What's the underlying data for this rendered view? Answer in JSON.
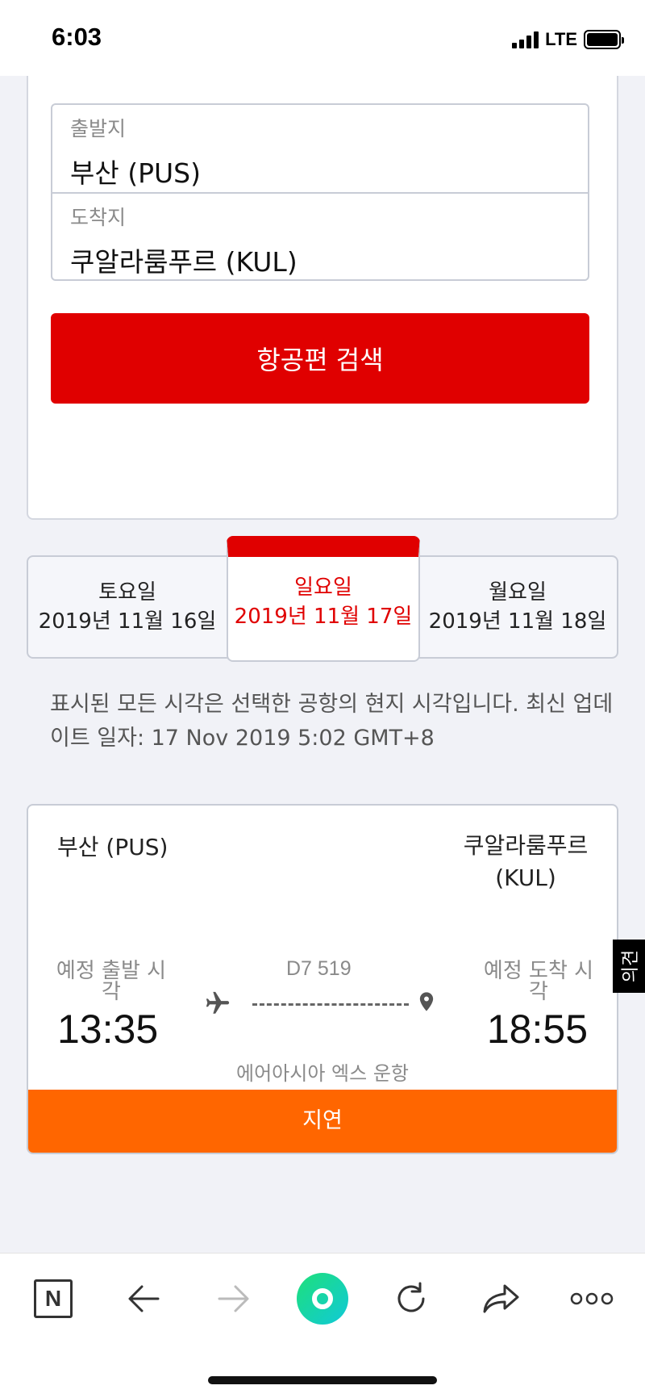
{
  "status_bar": {
    "time": "6:03",
    "network": "LTE"
  },
  "search_form": {
    "origin_label": "출발지",
    "origin_value": "부산 (PUS)",
    "destination_label": "도착지",
    "destination_value": "쿠알라룸푸르 (KUL)",
    "search_button": "항공편 검색"
  },
  "date_tabs": [
    {
      "day": "토요일",
      "date": "2019년 11월 16일",
      "selected": false
    },
    {
      "day": "일요일",
      "date": "2019년 11월 17일",
      "selected": true
    },
    {
      "day": "월요일",
      "date": "2019년 11월 18일",
      "selected": false
    }
  ],
  "notice": "표시된 모든 시각은 선택한 공항의 현지 시각입니다. 최신 업데이트 일자: 17 Nov 2019 5:02 GMT+8",
  "flight": {
    "origin": "부산 (PUS)",
    "destination": "쿠알라룸푸르 (KUL)",
    "dep_label": "예정 출발 시각",
    "arr_label": "예정 도착 시각",
    "dep_time": "13:35",
    "arr_time": "18:55",
    "flight_number": "D7 519",
    "operator": "에어아시아 엑스 운항",
    "status": "지연"
  },
  "feedback_tab": "의견",
  "bottom_nav": {
    "naver_label": "N",
    "icons": [
      "naver-icon",
      "back-arrow-icon",
      "forward-arrow-icon",
      "green-dot-icon",
      "refresh-icon",
      "share-icon",
      "more-icon"
    ]
  },
  "colors": {
    "accent_red": "#e00000",
    "status_orange": "#ff6600"
  }
}
